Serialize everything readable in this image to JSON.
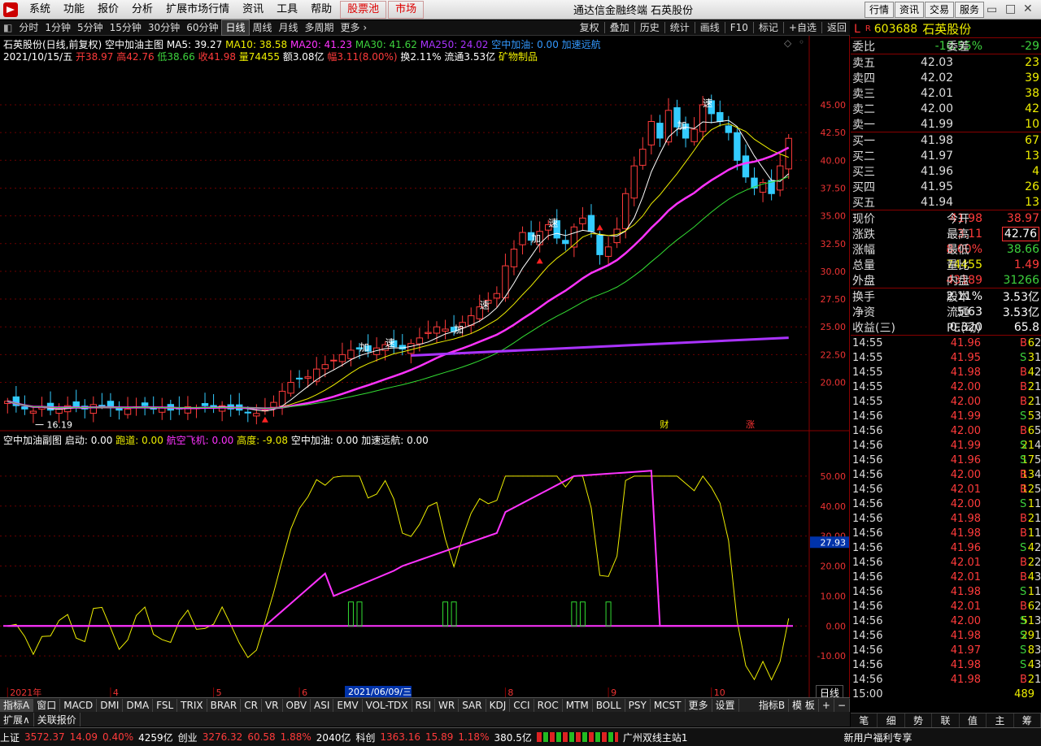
{
  "menu": {
    "items": [
      "系统",
      "功能",
      "报价",
      "分析",
      "扩展市场行情",
      "资讯",
      "工具",
      "帮助"
    ],
    "hl1": "股票池",
    "hl2": "市场",
    "title": "通达信金融终端  石英股份",
    "right": [
      "行情",
      "资讯",
      "交易",
      "服务"
    ]
  },
  "toolbar": {
    "items": [
      "分时",
      "1分钟",
      "5分钟",
      "15分钟",
      "30分钟",
      "60分钟",
      "日线",
      "周线",
      "月线",
      "多周期",
      "更多 ›"
    ],
    "active": "日线",
    "right": [
      "复权",
      "叠加",
      "历史",
      "统计",
      "画线",
      "F10",
      "标记",
      "+自选",
      "返回"
    ]
  },
  "info": {
    "name": "石英股份(日线,前复权)",
    "formula": "空中加油主图",
    "ma5": "MA5: 39.27",
    "ma10": "MA10: 38.58",
    "ma20": "MA20: 41.23",
    "ma30": "MA30: 41.62",
    "ma250": "MA250: 24.02",
    "k1": "空中加油: 0.00",
    "k2": "加速远航",
    "date": "2021/10/15/五",
    "open": "开38.97",
    "high": "高42.76",
    "low": "低38.66",
    "close": "收41.98",
    "vol": "量74455",
    "amt": "额3.08亿",
    "pct": "幅3.11(8.00%)",
    "turn": "换2.11%",
    "flow": "流通3.53亿",
    "ind": "矿物制品"
  },
  "sub": {
    "name": "空中加油副图",
    "qd": "启动: 0.00",
    "pd": "跑道: 0.00",
    "hk": "航空飞机: 0.00",
    "gd": "高度: -9.08",
    "kz": "空中加油: 0.00",
    "js": "加速远航: 0.00"
  },
  "yaxis": [
    "45.00",
    "42.50",
    "40.00",
    "37.50",
    "35.00",
    "32.50",
    "30.00",
    "27.50",
    "25.00",
    "22.50",
    "20.00"
  ],
  "suby": [
    "50.00",
    "40.00",
    "30.00",
    "20.00",
    "10.00",
    "0.00",
    "-10.00"
  ],
  "subcur": "27.93",
  "xlabels": [
    "2021年",
    "4",
    "5",
    "6",
    "7",
    "8",
    "9",
    "10"
  ],
  "xcursor": "2021/06/09/三",
  "lowlabel": "16.19",
  "marks": {
    "cb": "财",
    "zh": "涨",
    "jia": "加",
    "su": "速"
  },
  "chart_data": {
    "type": "candlestick",
    "symbol": "石英股份",
    "period": "日线",
    "ylim": [
      15.5,
      48
    ],
    "close": [
      18.3,
      17.9,
      17.6,
      17.4,
      17.8,
      17.5,
      17.6,
      17.9,
      17.7,
      17.6,
      18.0,
      17.9,
      17.7,
      17.5,
      17.6,
      17.8,
      17.9,
      17.6,
      17.7,
      17.5,
      17.6,
      17.8,
      17.7,
      17.9,
      17.8,
      17.9,
      17.6,
      17.5,
      17.3,
      17.2,
      17.5,
      18.2,
      19.2,
      20.0,
      20.3,
      20.5,
      21.2,
      21.6,
      22.0,
      22.5,
      22.9,
      23.0,
      22.8,
      23.1,
      23.4,
      23.2,
      23.0,
      23.5,
      24.0,
      24.5,
      25.0,
      24.8,
      24.6,
      25.4,
      26.0,
      26.8,
      27.4,
      28.0,
      30.5,
      32.0,
      33.5,
      32.8,
      33.6,
      34.2,
      33.0,
      32.5,
      34.0,
      34.8,
      33.6,
      31.5,
      32.2,
      33.8,
      37.0,
      39.5,
      41.0,
      43.5,
      42.0,
      44.5,
      43.0,
      42.0,
      42.8,
      45.0,
      44.2,
      43.5,
      42.5,
      40.0,
      38.5,
      37.5,
      38.0,
      37.0,
      39.5,
      41.98
    ],
    "ma250_note": "MA250: 24.02"
  },
  "quote": {
    "code": "603688",
    "name": "石英股份",
    "wb_lbl": "委比",
    "wb": "-10.55%",
    "wc_lbl": "委差",
    "wc": "-29",
    "asks": [
      [
        "卖五",
        "42.03",
        "23"
      ],
      [
        "卖四",
        "42.02",
        "39"
      ],
      [
        "卖三",
        "42.01",
        "38"
      ],
      [
        "卖二",
        "42.00",
        "42"
      ],
      [
        "卖一",
        "41.99",
        "10"
      ]
    ],
    "bids": [
      [
        "买一",
        "41.98",
        "67"
      ],
      [
        "买二",
        "41.97",
        "13"
      ],
      [
        "买三",
        "41.96",
        "4"
      ],
      [
        "买四",
        "41.95",
        "26"
      ],
      [
        "买五",
        "41.94",
        "13"
      ]
    ],
    "stats": [
      [
        "现价",
        "41.98",
        "今开",
        "38.97"
      ],
      [
        "涨跌",
        "3.11",
        "最高",
        "42.76"
      ],
      [
        "涨幅",
        "8.00%",
        "最低",
        "38.66"
      ],
      [
        "总量",
        "74455",
        "量比",
        "1.49"
      ],
      [
        "外盘",
        "43189",
        "内盘",
        "31266"
      ]
    ],
    "stats2": [
      [
        "换手",
        "2.11%",
        "股本",
        "3.53亿"
      ],
      [
        "净资",
        "5.63",
        "流通",
        "3.53亿"
      ],
      [
        "收益(三)",
        "0.320",
        "PE(动)",
        "65.8"
      ]
    ]
  },
  "ticks": [
    [
      "14:55",
      "41.96",
      "6",
      "B",
      "2"
    ],
    [
      "14:55",
      "41.95",
      "3",
      "S",
      "1"
    ],
    [
      "14:55",
      "41.98",
      "4",
      "B",
      "2"
    ],
    [
      "14:55",
      "42.00",
      "2",
      "B",
      "1"
    ],
    [
      "14:55",
      "42.00",
      "2",
      "B",
      "1"
    ],
    [
      "14:56",
      "41.99",
      "5",
      "S",
      "3"
    ],
    [
      "14:56",
      "42.00",
      "6",
      "B",
      "5"
    ],
    [
      "14:56",
      "41.99",
      "21",
      "S",
      "4"
    ],
    [
      "14:56",
      "41.96",
      "17",
      "S",
      "5"
    ],
    [
      "14:56",
      "42.00",
      "13",
      "B",
      "4"
    ],
    [
      "14:56",
      "42.01",
      "12",
      "B",
      "5"
    ],
    [
      "14:56",
      "42.00",
      "1",
      "S",
      "1"
    ],
    [
      "14:56",
      "41.98",
      "2",
      "B",
      "1"
    ],
    [
      "14:56",
      "41.98",
      "1",
      "B",
      "1"
    ],
    [
      "14:56",
      "41.96",
      "4",
      "S",
      "2"
    ],
    [
      "14:56",
      "42.01",
      "2",
      "B",
      "2"
    ],
    [
      "14:56",
      "42.01",
      "4",
      "B",
      "3"
    ],
    [
      "14:56",
      "41.98",
      "1",
      "S",
      "1"
    ],
    [
      "14:56",
      "42.01",
      "6",
      "B",
      "2"
    ],
    [
      "14:56",
      "42.00",
      "51",
      "S",
      "3"
    ],
    [
      "14:56",
      "41.98",
      "29",
      "S",
      "1"
    ],
    [
      "14:56",
      "41.97",
      "8",
      "S",
      "3"
    ],
    [
      "14:56",
      "41.98",
      "4",
      "S",
      "3"
    ],
    [
      "14:56",
      "41.98",
      "2",
      "B",
      "1"
    ],
    [
      "15:00",
      "",
      "489",
      "",
      ""
    ]
  ],
  "tabs1": [
    "指标A",
    "窗口",
    "MACD",
    "DMI",
    "DMA",
    "FSL",
    "TRIX",
    "BRAR",
    "CR",
    "VR",
    "OBV",
    "ASI",
    "EMV",
    "VOL-TDX",
    "RSI",
    "WR",
    "SAR",
    "KDJ",
    "CCI",
    "ROC",
    "MTM",
    "BOLL",
    "PSY",
    "MCST",
    "更多",
    "设置"
  ],
  "tabs1r": [
    "指标B",
    "模 板"
  ],
  "tabs2": [
    "扩展∧",
    "关联报价"
  ],
  "rtabs": [
    "笔",
    "细",
    "势",
    "联",
    "值",
    "主",
    "筹"
  ],
  "newuser": "新用户福利专享",
  "status": {
    "sh_l": "上证",
    "sh": "3572.37",
    "sh_c": "14.09",
    "sh_p": "0.40%",
    "sh_v": "4259亿",
    "cy_l": "创业",
    "cy": "3276.32",
    "cy_c": "60.58",
    "cy_p": "1.88%",
    "cy_v": "2040亿",
    "kc_l": "科创",
    "kc": "1363.16",
    "kc_c": "15.89",
    "kc_p": "1.18%",
    "kc_v": "380.5亿",
    "site": "广州双线主站1"
  },
  "daily_btn": "日线",
  "lmark": "L",
  "rmark": "R"
}
